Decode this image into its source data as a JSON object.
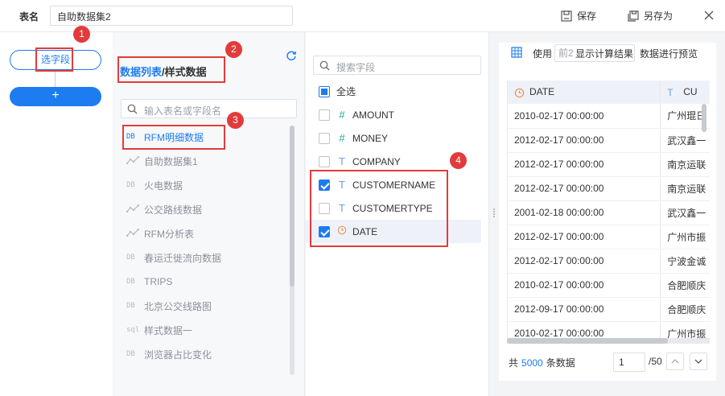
{
  "header": {
    "table_name_label": "表名",
    "table_name_value": "自助数据集2",
    "save_label": "保存",
    "save_as_label": "另存为"
  },
  "steps": {
    "select_fields_label": "选字段",
    "add_label": "+"
  },
  "tables_panel": {
    "title_active": "数据列表",
    "title_separator": "/",
    "title_rest": "样式数据",
    "search_placeholder": "输入表名或字段名",
    "items": [
      {
        "icon": "DB",
        "label": "RFM明细数据"
      },
      {
        "icon": "dataset",
        "label": "自助数据集1"
      },
      {
        "icon": "DB",
        "label": "火电数据"
      },
      {
        "icon": "dataset",
        "label": "公交路线数据"
      },
      {
        "icon": "dataset",
        "label": "RFM分析表"
      },
      {
        "icon": "DB",
        "label": "春运迁徙流向数据"
      },
      {
        "icon": "DB",
        "label": "TRIPS"
      },
      {
        "icon": "DB",
        "label": "北京公交线路图"
      },
      {
        "icon": "sql",
        "label": "样式数据一"
      },
      {
        "icon": "DB",
        "label": "浏览器占比变化"
      }
    ]
  },
  "fields_panel": {
    "search_placeholder": "搜索字段",
    "select_all_label": "全选",
    "items": [
      {
        "type": "#",
        "name": "AMOUNT",
        "checked": false
      },
      {
        "type": "#",
        "name": "MONEY",
        "checked": false
      },
      {
        "type": "T",
        "name": "COMPANY",
        "checked": false
      },
      {
        "type": "T",
        "name": "CUSTOMERNAME",
        "checked": true
      },
      {
        "type": "T",
        "name": "CUSTOMERTYPE",
        "checked": false
      },
      {
        "type": "date",
        "name": "DATE",
        "checked": true
      }
    ]
  },
  "preview": {
    "use_label": "使用",
    "select_value": "前2",
    "show_label": "显示计算结果",
    "right_label": "数据进行预览",
    "columns": [
      "DATE",
      "CU"
    ],
    "rows": [
      [
        "2010-02-17 00:00:00",
        "广州琨日"
      ],
      [
        "2012-02-17 00:00:00",
        "武汉鑫一"
      ],
      [
        "2012-02-17 00:00:00",
        "南京运联"
      ],
      [
        "2012-02-17 00:00:00",
        "南京运联"
      ],
      [
        "2001-02-18 00:00:00",
        "武汉鑫一"
      ],
      [
        "2012-02-17 00:00:00",
        "广州市振"
      ],
      [
        "2012-02-17 00:00:00",
        "宁波金诚"
      ],
      [
        "2010-02-17 00:00:00",
        "合肥顺庆"
      ],
      [
        "2012-09-17 00:00:00",
        "合肥顺庆"
      ],
      [
        "2010-02-17 00:00:00",
        "广州市振"
      ]
    ],
    "pager": {
      "total_prefix": "共",
      "total_count": "5000",
      "total_suffix": "条数据",
      "page_value": "1",
      "page_total": "/50"
    }
  },
  "annotations": [
    "1",
    "2",
    "3",
    "4"
  ],
  "colors": {
    "accent": "#1c7cf0",
    "annotation": "#e23b3b"
  }
}
